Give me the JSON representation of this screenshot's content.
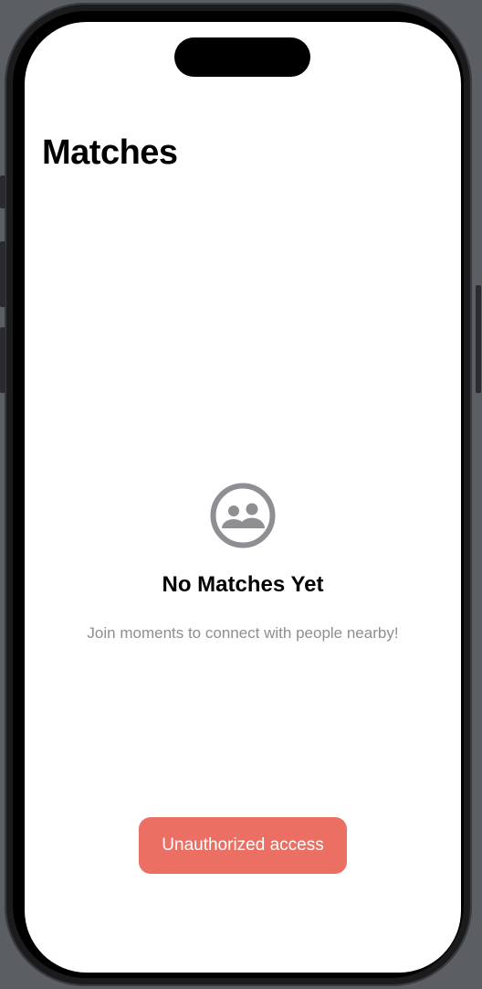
{
  "header": {
    "title": "Matches"
  },
  "empty_state": {
    "icon": "people-icon",
    "title": "No Matches Yet",
    "subtitle": "Join moments to connect with people nearby!"
  },
  "toast": {
    "message": "Unauthorized access"
  },
  "colors": {
    "toast_background": "#ec6f64",
    "icon_gray": "#8e8e93",
    "text_primary": "#000000",
    "text_secondary": "#8e8e93"
  }
}
